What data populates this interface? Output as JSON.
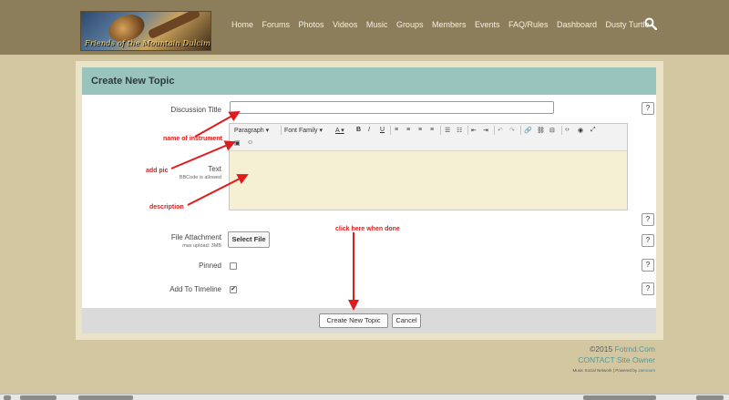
{
  "header": {
    "logo_text": "Friends of the Mountain Dulcimer",
    "nav": [
      "Home",
      "Forums",
      "Photos",
      "Videos",
      "Music",
      "Groups",
      "Members",
      "Events",
      "FAQ/Rules",
      "Dashboard",
      "Dusty Turtle"
    ],
    "search_icon": "search-icon"
  },
  "panel": {
    "title": "Create New Topic",
    "fields": {
      "discussion_title_label": "Discussion Title",
      "discussion_title_value": "",
      "text_label": "Text",
      "text_sub": "BBCode is allowed",
      "file_label": "File Attachment",
      "file_sub": "max upload: 3MB",
      "select_file": "Select File",
      "pinned_label": "Pinned",
      "pinned_checked": false,
      "timeline_label": "Add To Timeline",
      "timeline_checked": true,
      "help": "?"
    },
    "editor": {
      "paragraph": "Paragraph",
      "font_family": "Font Family",
      "bold": "B",
      "italic": "I",
      "underline": "U"
    },
    "footer": {
      "create_button": "Create New Topic",
      "cancel_button": "Cancel"
    }
  },
  "annotations": {
    "name": "name of instrument",
    "pic": "add pic",
    "description": "description",
    "done": "click here when done"
  },
  "footer": {
    "copyright_prefix": "©2015",
    "copyright_link": "Fotmd.Com",
    "contact": "CONTACT Site Owner",
    "powered_prefix": "Music Social Network | Powered by",
    "powered_link": "Jamroom"
  },
  "colors": {
    "header_bg": "#8c7d5b",
    "page_bg": "#d3c7a2",
    "panel_header": "#99c3bd",
    "annotation_red": "#e01b1b",
    "link_teal": "#4e9b9b"
  }
}
